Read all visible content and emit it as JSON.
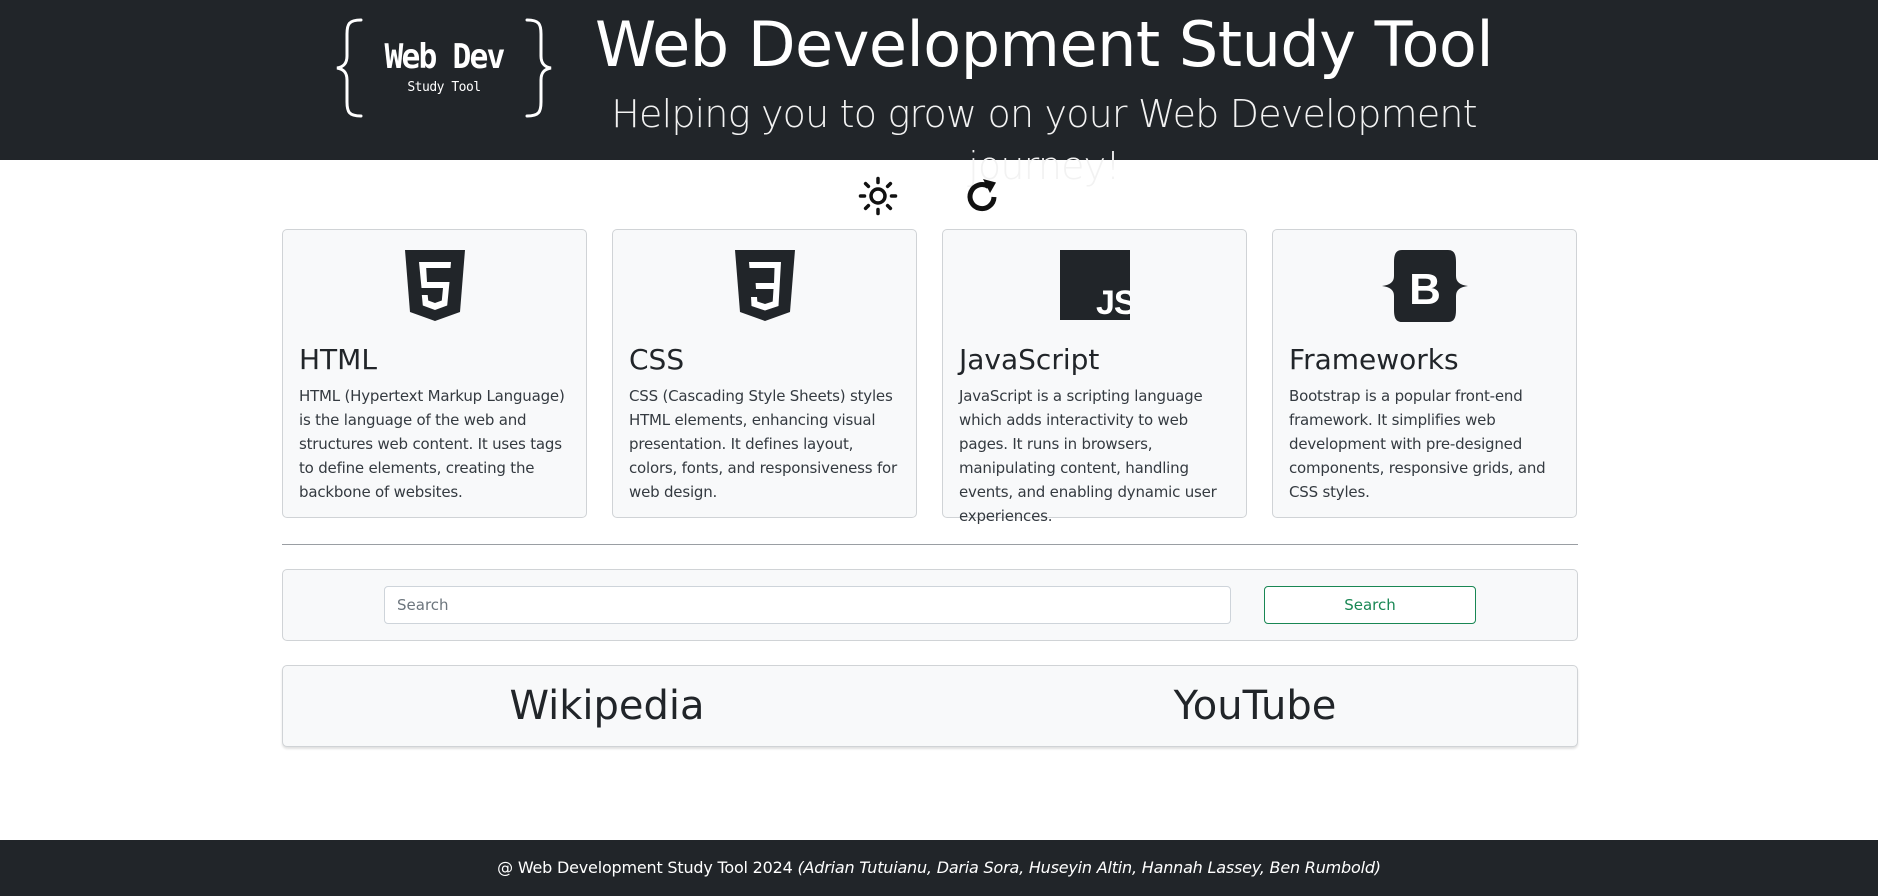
{
  "header": {
    "logo_main": "Web Dev",
    "logo_sub": "Study Tool",
    "title": "Web Development Study Tool",
    "subtitle": "Helping you to grow on your Web Development journey!"
  },
  "toolbar": {
    "theme_icon": "sun-icon",
    "refresh_icon": "refresh-icon"
  },
  "cards": [
    {
      "icon": "html5-icon",
      "title": "HTML",
      "text": "HTML (Hypertext Markup Language) is the language of the web and structures web content. It uses tags to define elements, creating the backbone of websites."
    },
    {
      "icon": "css3-icon",
      "title": "CSS",
      "text": "CSS (Cascading Style Sheets) styles HTML elements, enhancing visual presentation. It defines layout, colors, fonts, and responsiveness for web design."
    },
    {
      "icon": "javascript-icon",
      "title": "JavaScript",
      "text": "JavaScript is a scripting language which adds interactivity to web pages. It runs in browsers, manipulating content, handling events, and enabling dynamic user experiences."
    },
    {
      "icon": "bootstrap-icon",
      "title": "Frameworks",
      "text": "Bootstrap is a popular front-end framework. It simplifies web development with pre-designed components, responsive grids, and CSS styles."
    }
  ],
  "search": {
    "placeholder": "Search",
    "value": "",
    "button_label": "Search"
  },
  "links": {
    "wikipedia": "Wikipedia",
    "youtube": "YouTube"
  },
  "footer": {
    "text": "@ Web Development Study Tool 2024",
    "authors": "(Adrian Tutuianu, Daria Sora, Huseyin Altin, Hannah Lassey, Ben Rumbold)"
  },
  "colors": {
    "header_bg": "#212529",
    "card_bg": "#f8f9fa",
    "search_button_accent": "#198754"
  }
}
